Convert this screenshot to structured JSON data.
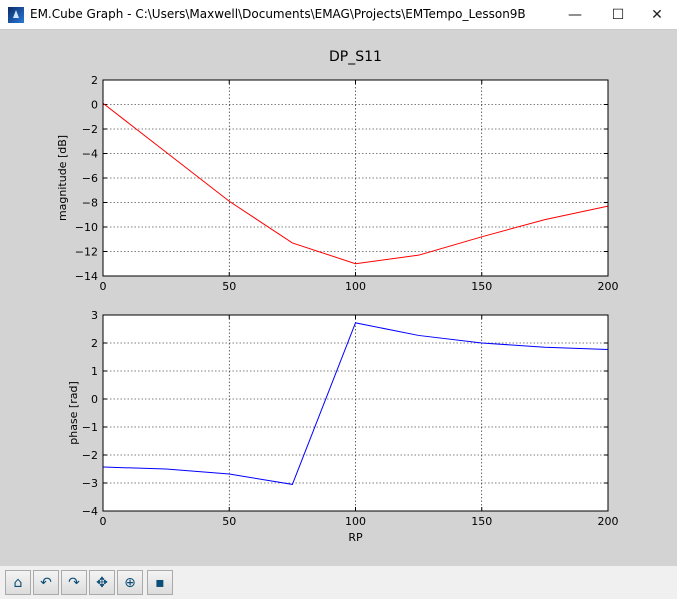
{
  "window": {
    "title": "EM.Cube Graph - C:\\Users\\Maxwell\\Documents\\EMAG\\Projects\\EMTempo_Lesson9B",
    "minimize": "—",
    "maximize": "☐",
    "close": "✕"
  },
  "toolbar": [
    {
      "name": "home",
      "glyph": "⌂"
    },
    {
      "name": "back",
      "glyph": "↶"
    },
    {
      "name": "forward",
      "glyph": "↷"
    },
    {
      "name": "pan",
      "glyph": "✥"
    },
    {
      "name": "zoom",
      "glyph": "⊕"
    },
    {
      "name": "save",
      "glyph": "▪"
    }
  ],
  "chart_data": [
    {
      "type": "line",
      "title": "DP_S11",
      "xlabel": "",
      "ylabel": "magnitude [dB]",
      "x": [
        0,
        25,
        50,
        75,
        100,
        125,
        150,
        175,
        200
      ],
      "series": [
        {
          "name": "magnitude",
          "color": "#ff0000",
          "values": [
            0.1,
            -3.9,
            -7.9,
            -11.3,
            -13.0,
            -12.3,
            -10.8,
            -9.4,
            -8.3
          ]
        }
      ],
      "xlim": [
        0,
        200
      ],
      "ylim": [
        -14,
        2
      ],
      "xticks": [
        0,
        50,
        100,
        150,
        200
      ],
      "yticks": [
        2,
        0,
        -2,
        -4,
        -6,
        -8,
        -10,
        -12,
        -14
      ],
      "grid": true
    },
    {
      "type": "line",
      "xlabel": "RP",
      "ylabel": "phase [rad]",
      "x": [
        0,
        25,
        50,
        75,
        100,
        125,
        150,
        175,
        200
      ],
      "series": [
        {
          "name": "phase",
          "color": "#0000ff",
          "values": [
            -2.43,
            -2.5,
            -2.68,
            -3.05,
            2.72,
            2.27,
            2.0,
            1.85,
            1.77
          ]
        }
      ],
      "xlim": [
        0,
        200
      ],
      "ylim": [
        -4,
        3
      ],
      "xticks": [
        0,
        50,
        100,
        150,
        200
      ],
      "yticks": [
        3,
        2,
        1,
        0,
        -1,
        -2,
        -3,
        -4
      ],
      "grid": true
    }
  ]
}
